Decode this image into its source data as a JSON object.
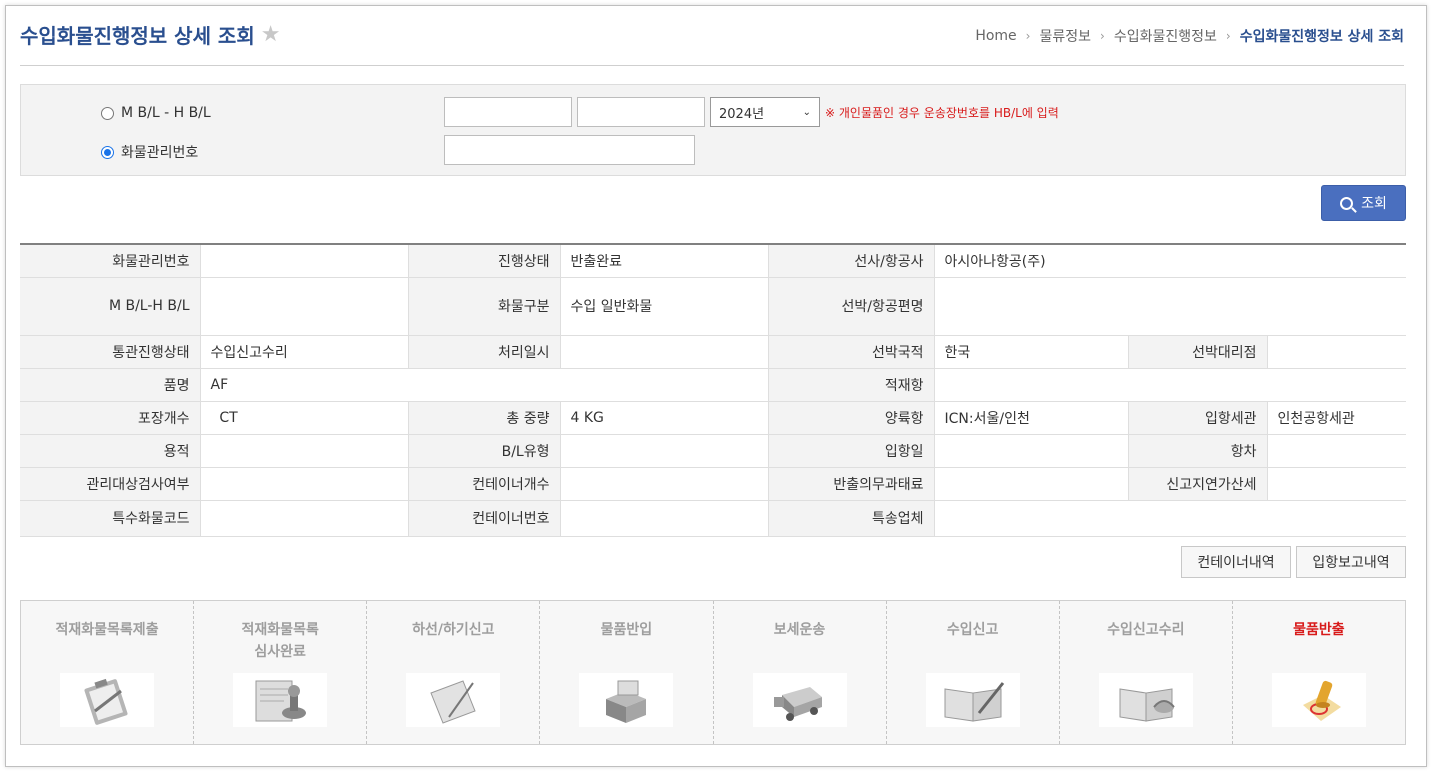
{
  "header": {
    "title": "수입화물진행정보 상세 조회",
    "breadcrumb": [
      "Home",
      "물류정보",
      "수입화물진행정보",
      "수입화물진행정보 상세 조회"
    ]
  },
  "search": {
    "option_mbl": "M B/L - H B/L",
    "option_cargo": "화물관리번호",
    "selected_option": "화물관리번호",
    "mbl_value": "",
    "hbl_value": "",
    "cargo_no_value": "",
    "year_selected": "2024년",
    "note": "※ 개인물품인 경우 운송장번호를 HB/L에 입력",
    "button_label": "조회"
  },
  "info": {
    "rows": [
      [
        {
          "label": "화물관리번호",
          "value": ""
        },
        {
          "label": "진행상태",
          "value": "반출완료"
        },
        {
          "label": "선사/항공사",
          "value": "아시아나항공(주)"
        }
      ],
      [
        {
          "label": "M B/L-H B/L",
          "value": ""
        },
        {
          "label": "화물구분",
          "value": "수입 일반화물"
        },
        {
          "label": "선박/항공편명",
          "value": ""
        }
      ],
      [
        {
          "label": "통관진행상태",
          "value": "수입신고수리"
        },
        {
          "label": "처리일시",
          "value": ""
        },
        {
          "label": "선박국적",
          "value": "한국"
        },
        {
          "label": "선박대리점",
          "value": ""
        }
      ],
      [
        {
          "label": "품명",
          "value": "AF"
        },
        {
          "label": "적재항",
          "value": ""
        }
      ],
      [
        {
          "label": "포장개수",
          "value": "  CT"
        },
        {
          "label": "총 중량",
          "value": "4 KG"
        },
        {
          "label": "양륙항",
          "value": "ICN:서울/인천"
        },
        {
          "label": "입항세관",
          "value": "인천공항세관"
        }
      ],
      [
        {
          "label": "용적",
          "value": ""
        },
        {
          "label": "B/L유형",
          "value": ""
        },
        {
          "label": "입항일",
          "value": ""
        },
        {
          "label": "항차",
          "value": ""
        }
      ],
      [
        {
          "label": "관리대상검사여부",
          "value": ""
        },
        {
          "label": "컨테이너개수",
          "value": ""
        },
        {
          "label": "반출의무과태료",
          "value": ""
        },
        {
          "label": "신고지연가산세",
          "value": ""
        }
      ],
      [
        {
          "label": "특수화물코드",
          "value": ""
        },
        {
          "label": "컨테이너번호",
          "value": ""
        },
        {
          "label": "특송업체",
          "value": ""
        }
      ]
    ]
  },
  "actions": {
    "container_label": "컨테이너내역",
    "arrival_label": "입항보고내역"
  },
  "steps": [
    {
      "line1": "적재화물목록제출",
      "line2": "",
      "icon": "clipboard-icon"
    },
    {
      "line1": "적재화물목록",
      "line2": "심사완료",
      "icon": "stamp-document-icon"
    },
    {
      "line1": "하선/하기신고",
      "line2": "",
      "icon": "pen-tablet-icon"
    },
    {
      "line1": "물품반입",
      "line2": "",
      "icon": "boxes-icon"
    },
    {
      "line1": "보세운송",
      "line2": "",
      "icon": "truck-icon"
    },
    {
      "line1": "수입신고",
      "line2": "",
      "icon": "open-book-pen-icon"
    },
    {
      "line1": "수입신고수리",
      "line2": "",
      "icon": "book-stamp-icon"
    },
    {
      "line1": "물품반출",
      "line2": "",
      "icon": "seal-icon",
      "active": true
    }
  ]
}
